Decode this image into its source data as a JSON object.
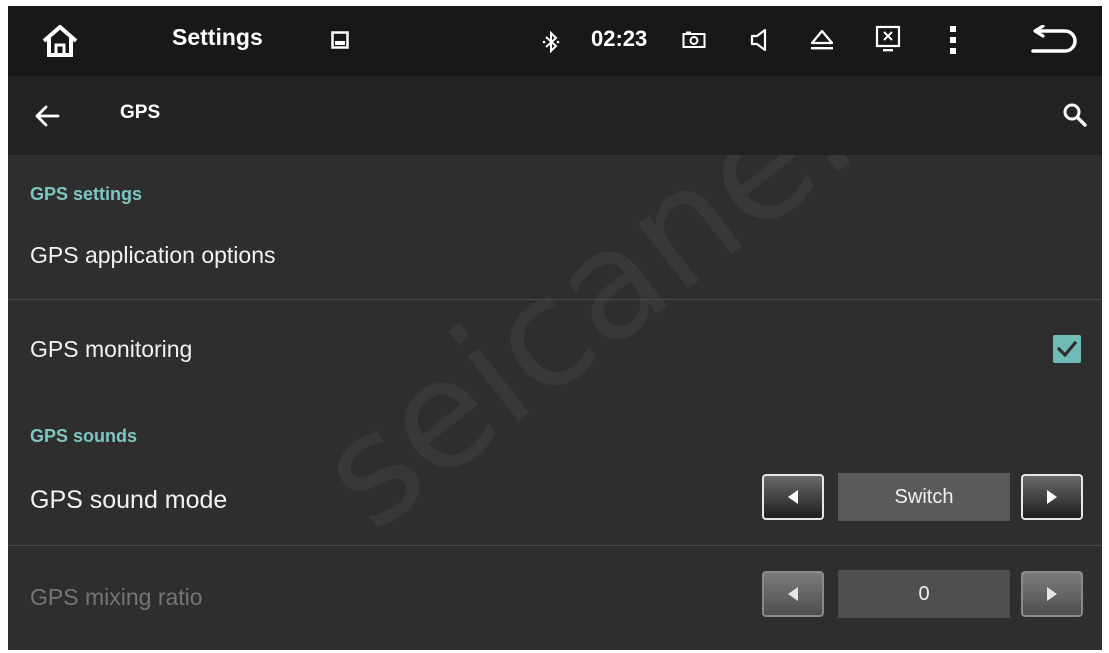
{
  "status_bar": {
    "title": "Settings",
    "time": "02:23",
    "icons": [
      "home-icon",
      "gallery-icon",
      "bluetooth-icon",
      "camera-icon",
      "volume-icon",
      "eject-icon",
      "close-window-icon",
      "more-vert-icon",
      "back-return-icon"
    ]
  },
  "app_bar": {
    "title": "GPS",
    "icons": [
      "back-arrow-icon",
      "search-icon"
    ]
  },
  "content": {
    "section_gps_settings": "GPS settings",
    "gps_application_options": "GPS application options",
    "gps_monitoring": {
      "label": "GPS monitoring",
      "checked": true
    },
    "section_gps_sounds": "GPS sounds",
    "gps_sound_mode": {
      "label": "GPS sound mode",
      "value": "Switch"
    },
    "gps_mixing_ratio": {
      "label": "GPS mixing ratio",
      "value": "0",
      "enabled": false
    }
  },
  "watermark": "seicane.com",
  "colors": {
    "accent": "#7ec6c2",
    "checkbox": "#6fbcb7",
    "background": "#2e2e2e",
    "status_bar": "#181818",
    "app_bar": "#232323"
  }
}
